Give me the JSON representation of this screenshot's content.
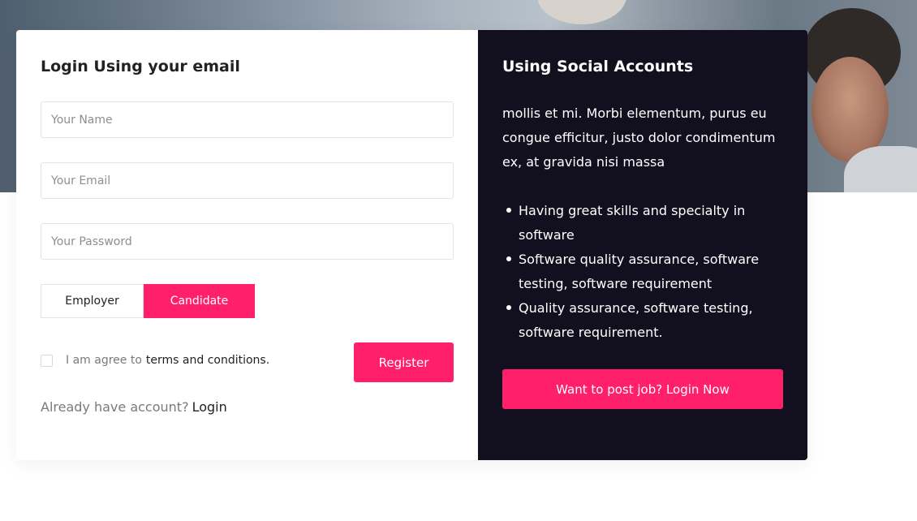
{
  "login_panel": {
    "title": "Login Using your email",
    "name_placeholder": "Your Name",
    "email_placeholder": "Your Email",
    "password_placeholder": "Your Password",
    "roles": {
      "employer": "Employer",
      "candidate": "Candidate",
      "selected": "Candidate"
    },
    "agree_prefix": "I am agree to",
    "agree_link": "terms and conditions.",
    "register_label": "Register",
    "already_text": "Already have account?",
    "login_link": "Login"
  },
  "social_panel": {
    "title": "Using Social Accounts",
    "description": "mollis et mi. Morbi elementum, purus eu congue efficitur, justo dolor condimentum ex, at gravida nisi massa",
    "features": [
      "Having great skills and specialty in software",
      "Software quality assurance, software testing, software requirement",
      "Quality assurance, software testing, software requirement."
    ],
    "cta_label": "Want to post job? Login Now"
  },
  "colors": {
    "accent": "#ff1f6a",
    "dark_panel": "#12101f"
  }
}
